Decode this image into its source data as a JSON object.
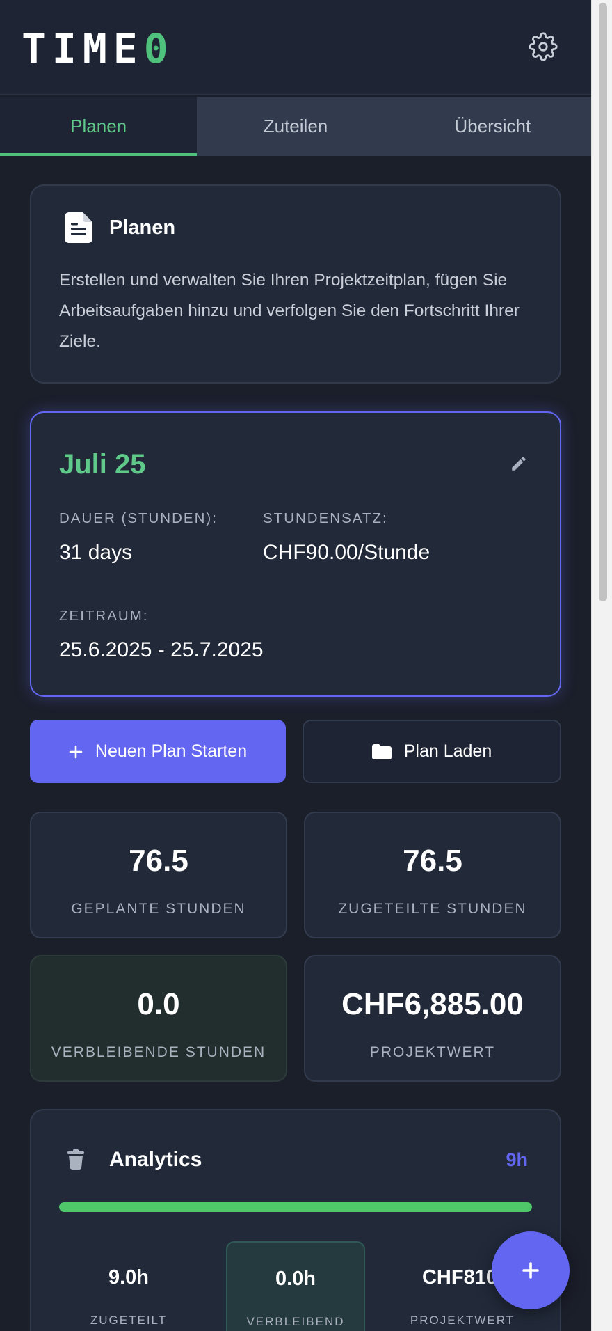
{
  "app": {
    "logo_main": "TIME",
    "logo_accent": "0"
  },
  "tabs": [
    {
      "label": "Planen",
      "active": true
    },
    {
      "label": "Zuteilen",
      "active": false
    },
    {
      "label": "Übersicht",
      "active": false
    }
  ],
  "intro": {
    "icon": "document-icon",
    "title": "Planen",
    "text": "Erstellen und verwalten Sie Ihren Projektzeitplan, fügen Sie Arbeitsaufgaben hinzu und verfolgen Sie den Fortschritt Ihrer Ziele."
  },
  "plan": {
    "title": "Juli 25",
    "duration_label": "DAUER (STUNDEN):",
    "duration_value": "31 days",
    "rate_label": "STUNDENSATZ:",
    "rate_value": "CHF90.00/Stunde",
    "period_label": "ZEITRAUM:",
    "period_value": "25.6.2025 - 25.7.2025"
  },
  "actions": {
    "new_plan": "Neuen Plan Starten",
    "load_plan": "Plan Laden"
  },
  "stats": {
    "planned": {
      "value": "76.5",
      "label": "GEPLANTE STUNDEN"
    },
    "allocated": {
      "value": "76.5",
      "label": "ZUGETEILTE STUNDEN"
    },
    "remaining": {
      "value": "0.0",
      "label": "VERBLEIBENDE STUNDEN"
    },
    "project_value": {
      "value": "CHF6,885.00",
      "label": "PROJEKTWERT"
    }
  },
  "analytics": {
    "title": "Analytics",
    "hours": "9h",
    "progress_fraction": 1.0,
    "allocated": {
      "value": "9.0h",
      "label": "ZUGETEILT"
    },
    "remaining": {
      "value": "0.0h",
      "label": "VERBLEIBEND"
    },
    "project_value": {
      "value": "CHF810.",
      "label": "PROJEKTWERT"
    }
  },
  "colors": {
    "background": "#1b1f2a",
    "card": "#222a3a",
    "accent_green": "#4fc17c",
    "accent_purple": "#6366f1"
  }
}
